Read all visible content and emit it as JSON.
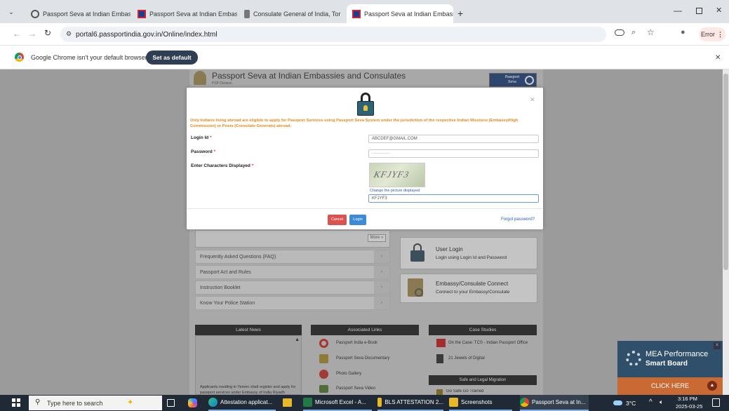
{
  "tabs": [
    {
      "title": "Passport Seva at Indian Embass"
    },
    {
      "title": "Passport Seva at Indian Embass"
    },
    {
      "title": "Consulate General of India, Tor"
    },
    {
      "title": "Passport Seva at Indian Embass"
    }
  ],
  "address": {
    "url": "portal6.passportindia.gov.in/Online/index.html",
    "error_label": "Error"
  },
  "infobar": {
    "message": "Google Chrome isn't your default browser",
    "button": "Set as default"
  },
  "site": {
    "title": "Passport Seva at Indian Embassies and Consulates",
    "subtitle": "PSP Division",
    "logo_text": "Passport Seva"
  },
  "modal": {
    "notice": "Only Indians living abroad are eligible to apply for Passport Services using Passport Seva System under the jurisdiction of the respective Indian Missions (Embassy/High Commission) or Posts (Consulate Generals) abroad.",
    "login_label": "Login Id",
    "login_value": "ABCDEF@GMAIL.COM",
    "password_label": "Password",
    "password_value": "·············",
    "captcha_label": "Enter Characters Displayed",
    "captcha_text": "KFJYF3",
    "change_picture": "Change the picture displayed",
    "captcha_value": "KFJYF3",
    "cancel": "Cancel",
    "login": "Login",
    "forgot": "Forgot password?"
  },
  "menu": {
    "more": "More »",
    "items": [
      "Frequently Asked Questions (FAQ)",
      "Passport Act and Rules",
      "Instruction Booklet",
      "Know Your Police Station"
    ]
  },
  "user_login": {
    "title": "User Login",
    "desc": "Login using Login Id and Password"
  },
  "embassy": {
    "title": "Embassy/Consulate Connect",
    "desc": "Connect to your Embassy/Consulate"
  },
  "news": {
    "header": "Latest News",
    "text": "Applicants residing in Yemen shall register and apply for passport services under Embassy of India Riyadh"
  },
  "assoc": {
    "header": "Associated Links",
    "items": [
      "Passport India e-Book",
      "Passport Seva Documentary",
      "Photo Gallery",
      "Passport Seva Video"
    ]
  },
  "case": {
    "header": "Case Studies",
    "items": [
      "On the Case: TCS - Indian Passport Office",
      "21 Jewels of Digital"
    ],
    "sub_header": "Safe and Legal Migration",
    "sub_item": "Go Safe Go Trained"
  },
  "promo": {
    "title": "MEA Performance",
    "subtitle": "Smart Board",
    "cta": "CLICK HERE"
  },
  "taskbar": {
    "search": "Type here to search",
    "apps": [
      "Attestation applicat...",
      "Microsoft Excel - A...",
      "BLS ATTESTATION 2...",
      "Screenshots",
      "Passport Seva at In..."
    ],
    "weather": "3°C",
    "time": "3:16 PM",
    "date": "2025-03-25"
  }
}
